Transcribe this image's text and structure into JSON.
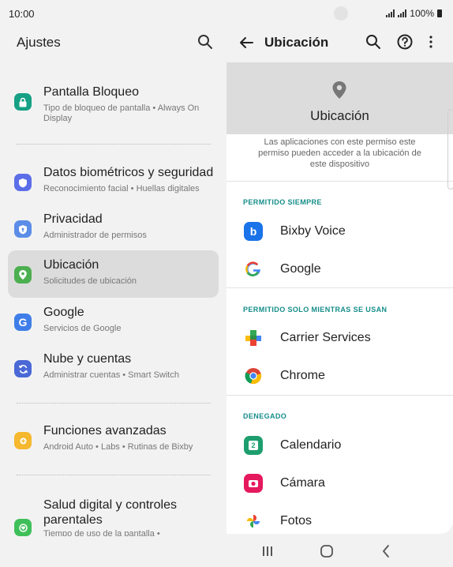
{
  "status_bar": {
    "time": "10:00",
    "battery": "100%",
    "icons": [
      "signal-icon",
      "signal-icon",
      "battery-icon"
    ]
  },
  "left_pane": {
    "title": "Ajustes",
    "search_icon": "search-icon",
    "items": [
      {
        "label": "Pantalla Bloqueo",
        "subtitle": "Tipo de bloqueo de pantalla  •  Always On Display",
        "icon": "lock-icon",
        "color": "#16a085"
      },
      {
        "label": "Datos biométricos y seguridad",
        "subtitle": "Reconocimiento facial  •  Huellas digitales",
        "icon": "shield-icon",
        "color": "#5b6ee8"
      },
      {
        "label": "Privacidad",
        "subtitle": "Administrador de permisos",
        "icon": "privacy-icon",
        "color": "#5b8de8"
      },
      {
        "label": "Ubicación",
        "subtitle": "Solicitudes de ubicación",
        "icon": "location-icon",
        "color": "#4caf50",
        "active": true
      },
      {
        "label": "Google",
        "subtitle": "Servicios de Google",
        "icon": "google-icon",
        "color": "#3f7ee8"
      },
      {
        "label": "Nube y cuentas",
        "subtitle": "Administrar cuentas  •  Smart Switch",
        "icon": "sync-icon",
        "color": "#4a68d6"
      },
      {
        "label": "Funciones avanzadas",
        "subtitle": "Android Auto  •  Labs  •  Rutinas de Bixby",
        "icon": "gear-plus-icon",
        "color": "#f5b82e"
      },
      {
        "label": "Salud digital y controles parentales",
        "subtitle": "Tiempo de uso de la pantalla  •",
        "icon": "digital-wellbeing-icon",
        "color": "#3fbf5a"
      }
    ]
  },
  "right_pane": {
    "title": "Ubicación",
    "hero_title": "Ubicación",
    "description": "Las aplicaciones con este permiso este permiso pueden acceder a la ubicación de este dispositivo",
    "sections": [
      {
        "header": "PERMITIDO SIEMPRE",
        "apps": [
          {
            "name": "Bixby Voice",
            "icon": "bixby-icon",
            "color": "#1a73e8"
          },
          {
            "name": "Google",
            "icon": "google-g-icon",
            "color": "#ffffff"
          }
        ]
      },
      {
        "header": "PERMITIDO SOLO MIENTRAS SE USAN",
        "apps": [
          {
            "name": "Carrier Services",
            "icon": "carrier-services-icon",
            "color": "#34a853"
          },
          {
            "name": "Chrome",
            "icon": "chrome-icon",
            "color": "#db4437"
          }
        ]
      },
      {
        "header": "DENEGADO",
        "apps": [
          {
            "name": "Calendario",
            "icon": "calendar-icon",
            "color": "#1e9e6e"
          },
          {
            "name": "Cámara",
            "icon": "camera-icon",
            "color": "#e5195e"
          },
          {
            "name": "Fotos",
            "icon": "photos-icon",
            "color": "#fbbc04"
          }
        ]
      }
    ],
    "accent": "#148d89"
  },
  "nav_bar": {
    "buttons": [
      "recents-icon",
      "home-icon",
      "back-icon"
    ]
  }
}
